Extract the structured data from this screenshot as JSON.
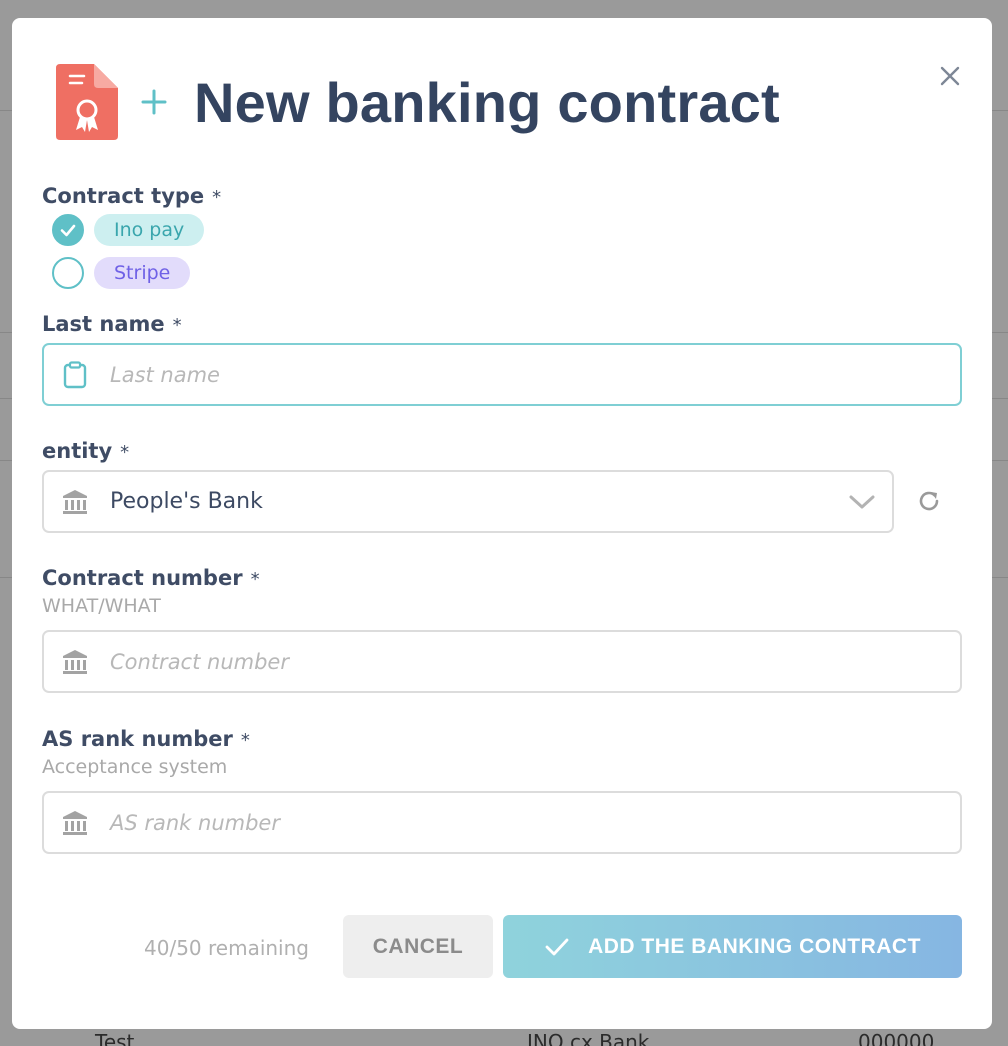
{
  "background": {
    "row_left": "Test",
    "row_middle": "INO cx Bank",
    "row_right": "000000"
  },
  "modal": {
    "title": "New banking contract",
    "close_icon": "close-icon",
    "doc_icon": "certificate-document-icon",
    "plus_icon": "plus-icon"
  },
  "contract_type": {
    "label": "Contract type",
    "required_mark": "*",
    "options": [
      {
        "label": "Ino pay",
        "checked": true
      },
      {
        "label": "Stripe",
        "checked": false
      }
    ]
  },
  "last_name": {
    "label": "Last name",
    "required_mark": "*",
    "placeholder": "Last name",
    "value": "",
    "icon": "clipboard-icon"
  },
  "entity": {
    "label": "entity",
    "required_mark": "*",
    "selected": "People's Bank",
    "icon": "bank-icon",
    "refresh_icon": "refresh-icon"
  },
  "contract_number": {
    "label": "Contract number",
    "required_mark": "*",
    "hint": "WHAT/WHAT",
    "placeholder": "Contract number",
    "icon": "bank-icon"
  },
  "as_rank": {
    "label": "AS rank number",
    "required_mark": "*",
    "hint": "Acceptance system",
    "placeholder": "AS rank number",
    "icon": "bank-icon"
  },
  "footer": {
    "remaining": "40/50 remaining",
    "cancel_label": "CANCEL",
    "submit_label": "ADD THE BANKING CONTRACT"
  },
  "colors": {
    "accent": "#5fc0c7",
    "title": "#344460",
    "doc_icon": "#ef6f63",
    "stripe_chip": "#e2dcfb",
    "ino_chip": "#cdeff0"
  }
}
